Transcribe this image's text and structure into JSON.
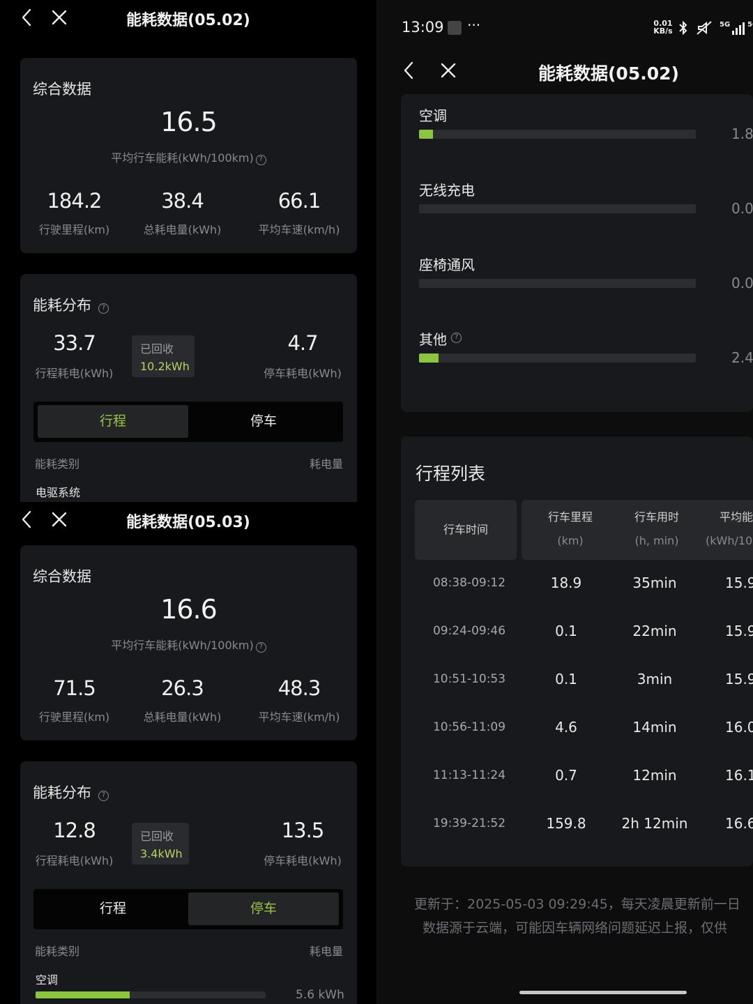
{
  "panel_a": {
    "title": "能耗数据(05.02)",
    "summary": {
      "heading": "综合数据",
      "avg_value": "16.5",
      "avg_label": "平均行车能耗(kWh/100km)",
      "stats": [
        {
          "value": "184.2",
          "label": "行驶里程(km)"
        },
        {
          "value": "38.4",
          "label": "总耗电量(kWh)"
        },
        {
          "value": "66.1",
          "label": "平均车速(km/h)"
        }
      ]
    },
    "distribution": {
      "heading": "能耗分布",
      "trip_value": "33.7",
      "trip_label": "行程耗电(kWh)",
      "recovered_label": "已回收",
      "recovered_value": "10.2kWh",
      "park_value": "4.7",
      "park_label": "停车耗电(kWh)",
      "tab_trip": "行程",
      "tab_park": "停车",
      "active_tab": "行程",
      "col_category": "能耗类别",
      "col_amount": "耗电量",
      "first_item": "电驱系统"
    }
  },
  "panel_b": {
    "title": "能耗数据(05.03)",
    "summary": {
      "heading": "综合数据",
      "avg_value": "16.6",
      "avg_label": "平均行车能耗(kWh/100km)",
      "stats": [
        {
          "value": "71.5",
          "label": "行驶里程(km)"
        },
        {
          "value": "26.3",
          "label": "总耗电量(kWh)"
        },
        {
          "value": "48.3",
          "label": "平均车速(km/h)"
        }
      ]
    },
    "distribution": {
      "heading": "能耗分布",
      "trip_value": "12.8",
      "trip_label": "行程耗电(kWh)",
      "recovered_label": "已回收",
      "recovered_value": "3.4kWh",
      "park_value": "13.5",
      "park_label": "停车耗电(kWh)",
      "tab_trip": "行程",
      "tab_park": "停车",
      "active_tab": "停车",
      "col_category": "能耗类别",
      "col_amount": "耗电量",
      "first_item": "空调",
      "first_item_value": "5.6 kWh",
      "first_item_fraction": 0.41
    }
  },
  "panel_c": {
    "status_time": "13:09",
    "status_more": "···",
    "status_speed": "0.01 KB/s",
    "title": "能耗数据(05.02)",
    "categories": [
      {
        "name": "空调",
        "value": "1.8",
        "fraction": 0.05
      },
      {
        "name": "无线充电",
        "value": "0.0",
        "fraction": 0
      },
      {
        "name": "座椅通风",
        "value": "0.0",
        "fraction": 0
      },
      {
        "name": "其他",
        "value": "2.4",
        "fraction": 0.07
      }
    ],
    "trips_heading": "行程列表",
    "headers": [
      {
        "line1": "行车时间",
        "line2": ""
      },
      {
        "line1": "行车里程",
        "line2": "(km)"
      },
      {
        "line1": "行车用时",
        "line2": "(h, min)"
      },
      {
        "line1": "平均能",
        "line2": "(kWh/10"
      }
    ],
    "rows": [
      {
        "time": "08:38-09:12",
        "distance": "18.9",
        "duration": "35min",
        "avg": "15.9"
      },
      {
        "time": "09:24-09:46",
        "distance": "0.1",
        "duration": "22min",
        "avg": "15.9"
      },
      {
        "time": "10:51-10:53",
        "distance": "0.1",
        "duration": "3min",
        "avg": "15.9"
      },
      {
        "time": "10:56-11:09",
        "distance": "4.6",
        "duration": "14min",
        "avg": "16.0"
      },
      {
        "time": "11:13-11:24",
        "distance": "0.7",
        "duration": "12min",
        "avg": "16.1"
      },
      {
        "time": "19:39-21:52",
        "distance": "159.8",
        "duration": "2h 12min",
        "avg": "16.6"
      }
    ],
    "footer_line1": "更新于：2025-05-03 09:29:45，每天凌晨更新前一日",
    "footer_line2": "数据源于云端，可能因车辆网络问题延迟上报，仅供"
  }
}
